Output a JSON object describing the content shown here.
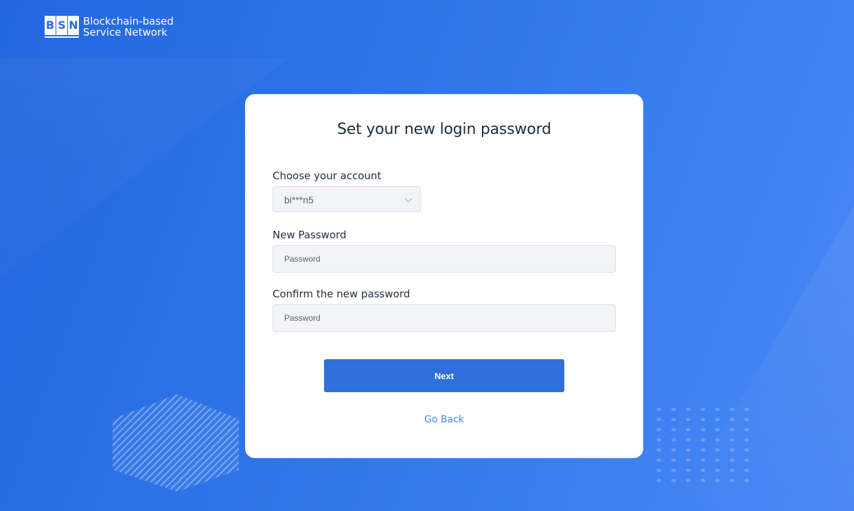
{
  "logo": {
    "letters": [
      "B",
      "S",
      "N"
    ],
    "line1": "Blockchain-based",
    "line2": "Service Network"
  },
  "card": {
    "title": "Set your new login password",
    "account": {
      "label": "Choose your account",
      "selected": "bi***n5",
      "arrow_icon": "chevron-down-icon"
    },
    "new_password": {
      "label": "New Password",
      "placeholder": "Password",
      "value": ""
    },
    "confirm_password": {
      "label": "Confirm the new password",
      "placeholder": "Password",
      "value": ""
    },
    "next_label": "Next",
    "go_back_label": "Go Back"
  },
  "colors": {
    "background": "#2d72e6",
    "primary_button": "#2e6fdb",
    "link": "#3a8ef0",
    "input_bg": "#f1f3f6"
  }
}
